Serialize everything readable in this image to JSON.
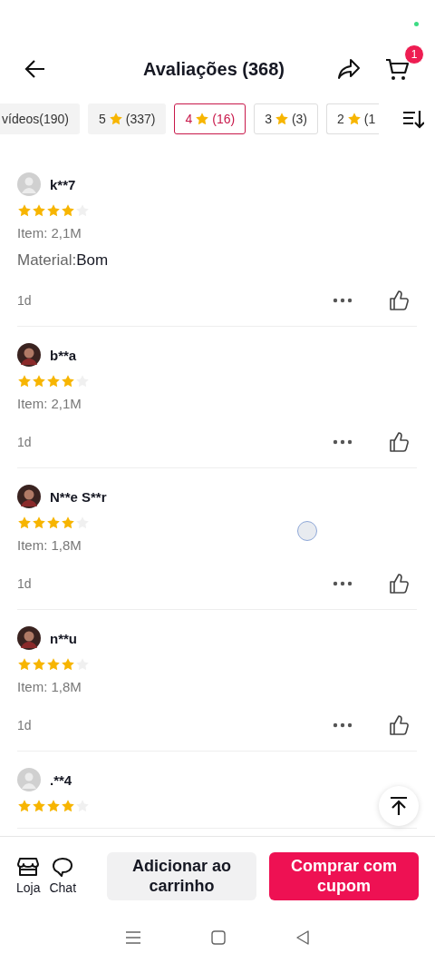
{
  "header": {
    "title": "Avaliações (368)",
    "cart_count": "1"
  },
  "filters": [
    {
      "kind": "text",
      "label": "vídeos(190)",
      "selected": false
    },
    {
      "kind": "rating",
      "label": "5",
      "count": "(337)",
      "selected": false
    },
    {
      "kind": "rating",
      "label": "4",
      "count": "(16)",
      "selected": true
    },
    {
      "kind": "rating",
      "label": "3",
      "count": "(3)",
      "selected": false
    },
    {
      "kind": "rating",
      "label": "2",
      "count": "(1",
      "selected": false
    }
  ],
  "reviews": [
    {
      "name": "k**7",
      "avatar": {
        "kind": "default"
      },
      "stars": 4,
      "item": "Item: 2,1M",
      "attributes": [
        {
          "label": "Material:",
          "value": "Bom"
        }
      ],
      "time": "1d"
    },
    {
      "name": "b**a",
      "avatar": {
        "kind": "photo"
      },
      "stars": 4,
      "item": "Item: 2,1M",
      "time": "1d"
    },
    {
      "name": "N**e S**r",
      "avatar": {
        "kind": "photo"
      },
      "stars": 4,
      "item": "Item: 1,8M",
      "time": "1d"
    },
    {
      "name": "n**u",
      "avatar": {
        "kind": "photo"
      },
      "stars": 4,
      "item": "Item: 1,8M",
      "time": "1d"
    },
    {
      "name": ".**4",
      "avatar": {
        "kind": "default"
      },
      "stars": 4
    }
  ],
  "bottom_bar": {
    "shop": "Loja",
    "chat": "Chat",
    "add_to_cart": "Adicionar ao carrinho",
    "buy": "Comprar com cupom"
  }
}
